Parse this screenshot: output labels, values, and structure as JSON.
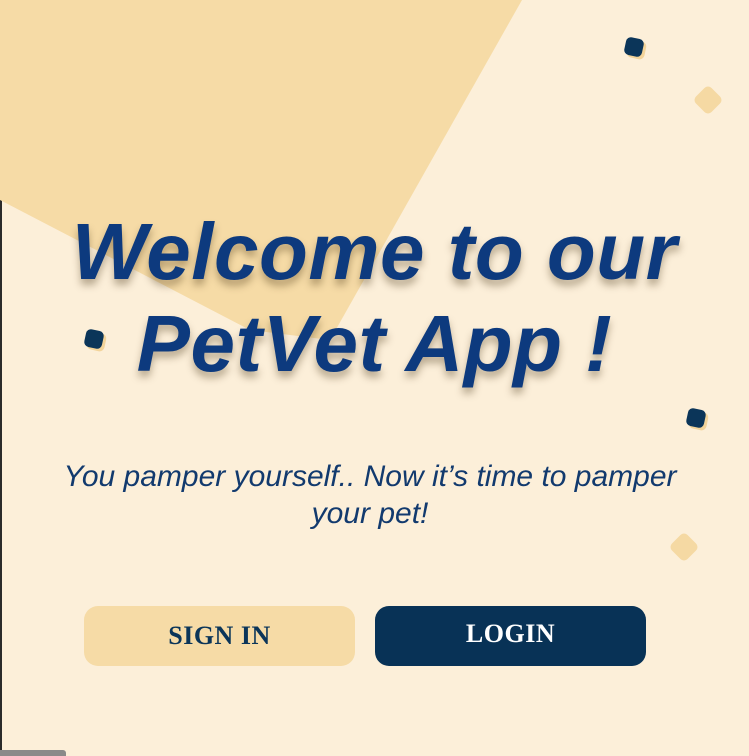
{
  "colors": {
    "background": "#fcefd9",
    "shape": "#f6dba6",
    "title": "#0d3a7e",
    "primary": "#083256",
    "dot_dark": "#0b3559",
    "dot_light": "#f5d9a3"
  },
  "welcome": {
    "title_line1": "Welcome to our",
    "title_line2": "PetVet App !",
    "subtitle": "You pamper yourself.. Now it’s time to pamper your pet!"
  },
  "actions": {
    "signin_label": "SIGN IN",
    "login_label": "LOGIN"
  }
}
